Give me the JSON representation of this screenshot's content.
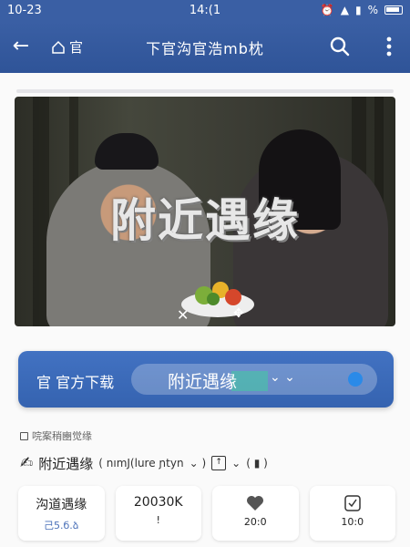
{
  "status_bar": {
    "time": "10-23",
    "center_time": "14:(1",
    "battery": "%"
  },
  "header": {
    "back_icon": "back-arrow-icon",
    "home_label": "官",
    "title": "下官沟官浩mb枕"
  },
  "banner": {
    "headline": "附近遇缘"
  },
  "download_bar": {
    "label": "官 官方下载",
    "field_text": "附近遇缘",
    "chevrons": "⌄ ⌄"
  },
  "tagline": "唍案稍豳觉缘",
  "selector": {
    "title": "附近遇缘",
    "subtitle": "( nımJ(lure ɲtyn",
    "small_dots": "( ▮ )"
  },
  "cards": [
    {
      "title": "沟道遇缘",
      "sub": "己5.б.ձ"
    },
    {
      "title": "20030K",
      "sub": "!"
    },
    {
      "title": "",
      "sub": "20:0"
    },
    {
      "title": "",
      "sub": "10:0"
    }
  ],
  "colors": {
    "header_blue": "#3a5fa4",
    "download_blue": "#3d6cba",
    "accent": "#2a8ae8"
  }
}
